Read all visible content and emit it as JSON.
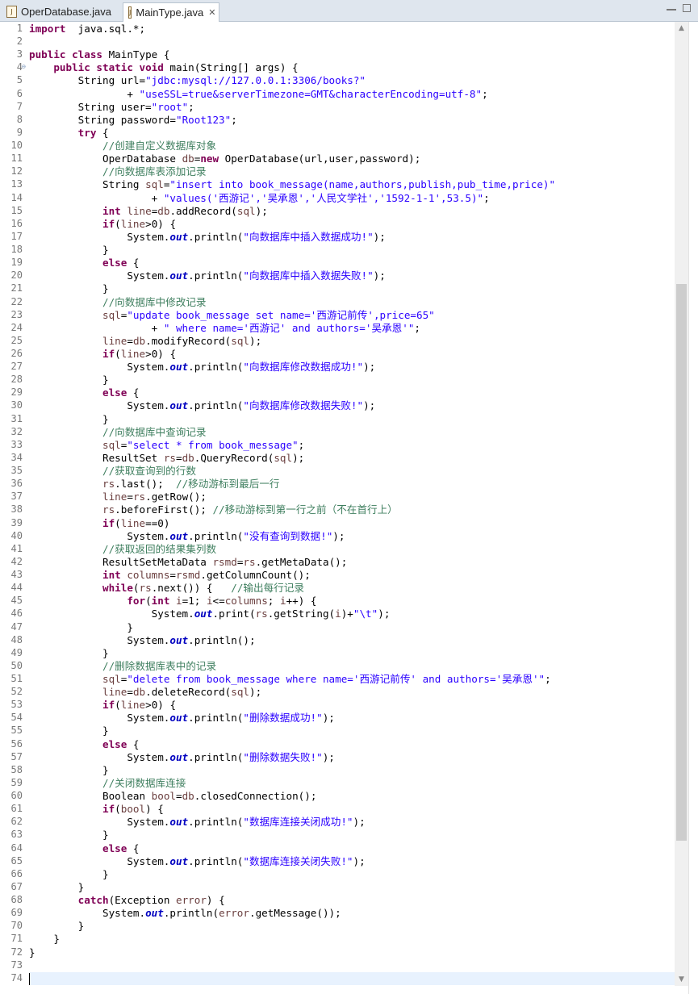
{
  "tabs": [
    {
      "label": "OperDatabase.java",
      "active": false
    },
    {
      "label": "MainType.java",
      "active": true
    }
  ],
  "editor": {
    "fold_markers": {
      "4": "⊖"
    },
    "current_line": 74,
    "lines": [
      [
        [
          "kw",
          "import"
        ],
        [
          "",
          "  java.sql.*;"
        ]
      ],
      [],
      [
        [
          "kw",
          "public class"
        ],
        [
          "",
          " MainType {"
        ]
      ],
      [
        [
          "",
          "    "
        ],
        [
          "kw",
          "public static void"
        ],
        [
          "",
          " main(String[] args) {"
        ]
      ],
      [
        [
          "",
          "        String url="
        ],
        [
          "str",
          "\"jdbc:mysql://127.0.0.1:3306/books?\""
        ]
      ],
      [
        [
          "",
          "                + "
        ],
        [
          "str",
          "\"useSSL=true&serverTimezone=GMT&characterEncoding=utf-8\""
        ],
        [
          "",
          ";"
        ]
      ],
      [
        [
          "",
          "        String user="
        ],
        [
          "str",
          "\"root\""
        ],
        [
          "",
          ";"
        ]
      ],
      [
        [
          "",
          "        String password="
        ],
        [
          "str",
          "\"Root123\""
        ],
        [
          "",
          ";"
        ]
      ],
      [
        [
          "",
          "        "
        ],
        [
          "kw",
          "try"
        ],
        [
          "",
          " {"
        ]
      ],
      [
        [
          "",
          "            "
        ],
        [
          "cm",
          "//创建自定义数据库对象"
        ]
      ],
      [
        [
          "",
          "            OperDatabase "
        ],
        [
          "var",
          "db"
        ],
        [
          "",
          "="
        ],
        [
          "kw",
          "new"
        ],
        [
          "",
          " OperDatabase(url,user,password);"
        ]
      ],
      [
        [
          "",
          "            "
        ],
        [
          "cm",
          "//向数据库表添加记录"
        ]
      ],
      [
        [
          "",
          "            String "
        ],
        [
          "var",
          "sql"
        ],
        [
          "",
          "="
        ],
        [
          "str",
          "\"insert into book_message(name,authors,publish,pub_time,price)\""
        ]
      ],
      [
        [
          "",
          "                    + "
        ],
        [
          "str",
          "\"values('西游记','吴承恩','人民文学社','1592-1-1',53.5)\""
        ],
        [
          "",
          ";"
        ]
      ],
      [
        [
          "",
          "            "
        ],
        [
          "kw",
          "int"
        ],
        [
          "",
          " "
        ],
        [
          "var",
          "line"
        ],
        [
          "",
          "="
        ],
        [
          "var",
          "db"
        ],
        [
          "",
          ".addRecord("
        ],
        [
          "var",
          "sql"
        ],
        [
          "",
          ");"
        ]
      ],
      [
        [
          "",
          "            "
        ],
        [
          "kw",
          "if"
        ],
        [
          "",
          "("
        ],
        [
          "var",
          "line"
        ],
        [
          "",
          ">0) {"
        ]
      ],
      [
        [
          "",
          "                System."
        ],
        [
          "fld",
          "out"
        ],
        [
          "",
          ".println("
        ],
        [
          "str",
          "\"向数据库中插入数据成功!\""
        ],
        [
          "",
          ");"
        ]
      ],
      [
        [
          "",
          "            }"
        ]
      ],
      [
        [
          "",
          "            "
        ],
        [
          "kw",
          "else"
        ],
        [
          "",
          " {"
        ]
      ],
      [
        [
          "",
          "                System."
        ],
        [
          "fld",
          "out"
        ],
        [
          "",
          ".println("
        ],
        [
          "str",
          "\"向数据库中插入数据失败!\""
        ],
        [
          "",
          ");"
        ]
      ],
      [
        [
          "",
          "            }"
        ]
      ],
      [
        [
          "",
          "            "
        ],
        [
          "cm",
          "//向数据库中修改记录"
        ]
      ],
      [
        [
          "",
          "            "
        ],
        [
          "var",
          "sql"
        ],
        [
          "",
          "="
        ],
        [
          "str",
          "\"update book_message set name='西游记前传',price=65\""
        ]
      ],
      [
        [
          "",
          "                    + "
        ],
        [
          "str",
          "\" where name='西游记' and authors='吴承恩'\""
        ],
        [
          "",
          ";"
        ]
      ],
      [
        [
          "",
          "            "
        ],
        [
          "var",
          "line"
        ],
        [
          "",
          "="
        ],
        [
          "var",
          "db"
        ],
        [
          "",
          ".modifyRecord("
        ],
        [
          "var",
          "sql"
        ],
        [
          "",
          ");"
        ]
      ],
      [
        [
          "",
          "            "
        ],
        [
          "kw",
          "if"
        ],
        [
          "",
          "("
        ],
        [
          "var",
          "line"
        ],
        [
          "",
          ">0) {"
        ]
      ],
      [
        [
          "",
          "                System."
        ],
        [
          "fld",
          "out"
        ],
        [
          "",
          ".println("
        ],
        [
          "str",
          "\"向数据库修改数据成功!\""
        ],
        [
          "",
          ");"
        ]
      ],
      [
        [
          "",
          "            }"
        ]
      ],
      [
        [
          "",
          "            "
        ],
        [
          "kw",
          "else"
        ],
        [
          "",
          " {"
        ]
      ],
      [
        [
          "",
          "                System."
        ],
        [
          "fld",
          "out"
        ],
        [
          "",
          ".println("
        ],
        [
          "str",
          "\"向数据库修改数据失败!\""
        ],
        [
          "",
          ");"
        ]
      ],
      [
        [
          "",
          "            }"
        ]
      ],
      [
        [
          "",
          "            "
        ],
        [
          "cm",
          "//向数据库中查询记录"
        ]
      ],
      [
        [
          "",
          "            "
        ],
        [
          "var",
          "sql"
        ],
        [
          "",
          "="
        ],
        [
          "str",
          "\"select * from book_message\""
        ],
        [
          "",
          ";"
        ]
      ],
      [
        [
          "",
          "            ResultSet "
        ],
        [
          "var",
          "rs"
        ],
        [
          "",
          "="
        ],
        [
          "var",
          "db"
        ],
        [
          "",
          ".QueryRecord("
        ],
        [
          "var",
          "sql"
        ],
        [
          "",
          ");"
        ]
      ],
      [
        [
          "",
          "            "
        ],
        [
          "cm",
          "//获取查询到的行数"
        ]
      ],
      [
        [
          "",
          "            "
        ],
        [
          "var",
          "rs"
        ],
        [
          "",
          ".last();  "
        ],
        [
          "cm",
          "//移动游标到最后一行"
        ]
      ],
      [
        [
          "",
          "            "
        ],
        [
          "var",
          "line"
        ],
        [
          "",
          "="
        ],
        [
          "var",
          "rs"
        ],
        [
          "",
          ".getRow();"
        ]
      ],
      [
        [
          "",
          "            "
        ],
        [
          "var",
          "rs"
        ],
        [
          "",
          ".beforeFirst(); "
        ],
        [
          "cm",
          "//移动游标到第一行之前（不在首行上）"
        ]
      ],
      [
        [
          "",
          "            "
        ],
        [
          "kw",
          "if"
        ],
        [
          "",
          "("
        ],
        [
          "var",
          "line"
        ],
        [
          "",
          "==0)"
        ]
      ],
      [
        [
          "",
          "                System."
        ],
        [
          "fld",
          "out"
        ],
        [
          "",
          ".println("
        ],
        [
          "str",
          "\"没有查询到数据!\""
        ],
        [
          "",
          ");"
        ]
      ],
      [
        [
          "",
          "            "
        ],
        [
          "cm",
          "//获取返回的结果集列数"
        ]
      ],
      [
        [
          "",
          "            ResultSetMetaData "
        ],
        [
          "var",
          "rsmd"
        ],
        [
          "",
          "="
        ],
        [
          "var",
          "rs"
        ],
        [
          "",
          ".getMetaData();"
        ]
      ],
      [
        [
          "",
          "            "
        ],
        [
          "kw",
          "int"
        ],
        [
          "",
          " "
        ],
        [
          "var",
          "columns"
        ],
        [
          "",
          "="
        ],
        [
          "var",
          "rsmd"
        ],
        [
          "",
          ".getColumnCount();"
        ]
      ],
      [
        [
          "",
          "            "
        ],
        [
          "kw",
          "while"
        ],
        [
          "",
          "("
        ],
        [
          "var",
          "rs"
        ],
        [
          "",
          ".next()) {   "
        ],
        [
          "cm",
          "//输出每行记录"
        ]
      ],
      [
        [
          "",
          "                "
        ],
        [
          "kw",
          "for"
        ],
        [
          "",
          "("
        ],
        [
          "kw",
          "int"
        ],
        [
          "",
          " "
        ],
        [
          "var",
          "i"
        ],
        [
          "",
          "=1; "
        ],
        [
          "var",
          "i"
        ],
        [
          "",
          "<="
        ],
        [
          "var",
          "columns"
        ],
        [
          "",
          "; "
        ],
        [
          "var",
          "i"
        ],
        [
          "",
          "++) {"
        ]
      ],
      [
        [
          "",
          "                    System."
        ],
        [
          "fld",
          "out"
        ],
        [
          "",
          ".print("
        ],
        [
          "var",
          "rs"
        ],
        [
          "",
          ".getString("
        ],
        [
          "var",
          "i"
        ],
        [
          "",
          ")+"
        ],
        [
          "str",
          "\"\\t\""
        ],
        [
          "",
          ");"
        ]
      ],
      [
        [
          "",
          "                }"
        ]
      ],
      [
        [
          "",
          "                System."
        ],
        [
          "fld",
          "out"
        ],
        [
          "",
          ".println();"
        ]
      ],
      [
        [
          "",
          "            }"
        ]
      ],
      [
        [
          "",
          "            "
        ],
        [
          "cm",
          "//删除数据库表中的记录"
        ]
      ],
      [
        [
          "",
          "            "
        ],
        [
          "var",
          "sql"
        ],
        [
          "",
          "="
        ],
        [
          "str",
          "\"delete from book_message where name='西游记前传' and authors='吴承恩'\""
        ],
        [
          "",
          ";"
        ]
      ],
      [
        [
          "",
          "            "
        ],
        [
          "var",
          "line"
        ],
        [
          "",
          "="
        ],
        [
          "var",
          "db"
        ],
        [
          "",
          ".deleteRecord("
        ],
        [
          "var",
          "sql"
        ],
        [
          "",
          ");"
        ]
      ],
      [
        [
          "",
          "            "
        ],
        [
          "kw",
          "if"
        ],
        [
          "",
          "("
        ],
        [
          "var",
          "line"
        ],
        [
          "",
          ">0) {"
        ]
      ],
      [
        [
          "",
          "                System."
        ],
        [
          "fld",
          "out"
        ],
        [
          "",
          ".println("
        ],
        [
          "str",
          "\"删除数据成功!\""
        ],
        [
          "",
          ");"
        ]
      ],
      [
        [
          "",
          "            }"
        ]
      ],
      [
        [
          "",
          "            "
        ],
        [
          "kw",
          "else"
        ],
        [
          "",
          " {"
        ]
      ],
      [
        [
          "",
          "                System."
        ],
        [
          "fld",
          "out"
        ],
        [
          "",
          ".println("
        ],
        [
          "str",
          "\"删除数据失败!\""
        ],
        [
          "",
          ");"
        ]
      ],
      [
        [
          "",
          "            }"
        ]
      ],
      [
        [
          "",
          "            "
        ],
        [
          "cm",
          "//关闭数据库连接"
        ]
      ],
      [
        [
          "",
          "            Boolean "
        ],
        [
          "var",
          "bool"
        ],
        [
          "",
          "="
        ],
        [
          "var",
          "db"
        ],
        [
          "",
          ".closedConnection();"
        ]
      ],
      [
        [
          "",
          "            "
        ],
        [
          "kw",
          "if"
        ],
        [
          "",
          "("
        ],
        [
          "var",
          "bool"
        ],
        [
          "",
          ") {"
        ]
      ],
      [
        [
          "",
          "                System."
        ],
        [
          "fld",
          "out"
        ],
        [
          "",
          ".println("
        ],
        [
          "str",
          "\"数据库连接关闭成功!\""
        ],
        [
          "",
          ");"
        ]
      ],
      [
        [
          "",
          "            }"
        ]
      ],
      [
        [
          "",
          "            "
        ],
        [
          "kw",
          "else"
        ],
        [
          "",
          " {"
        ]
      ],
      [
        [
          "",
          "                System."
        ],
        [
          "fld",
          "out"
        ],
        [
          "",
          ".println("
        ],
        [
          "str",
          "\"数据库连接关闭失败!\""
        ],
        [
          "",
          ");"
        ]
      ],
      [
        [
          "",
          "            }"
        ]
      ],
      [
        [
          "",
          "        }"
        ]
      ],
      [
        [
          "",
          "        "
        ],
        [
          "kw",
          "catch"
        ],
        [
          "",
          "(Exception "
        ],
        [
          "var",
          "error"
        ],
        [
          "",
          ") {"
        ]
      ],
      [
        [
          "",
          "            System."
        ],
        [
          "fld",
          "out"
        ],
        [
          "",
          ".println("
        ],
        [
          "var",
          "error"
        ],
        [
          "",
          ".getMessage());"
        ]
      ],
      [
        [
          "",
          "        }"
        ]
      ],
      [
        [
          "",
          "    }"
        ]
      ],
      [
        [
          "",
          "}"
        ]
      ],
      [],
      []
    ]
  }
}
